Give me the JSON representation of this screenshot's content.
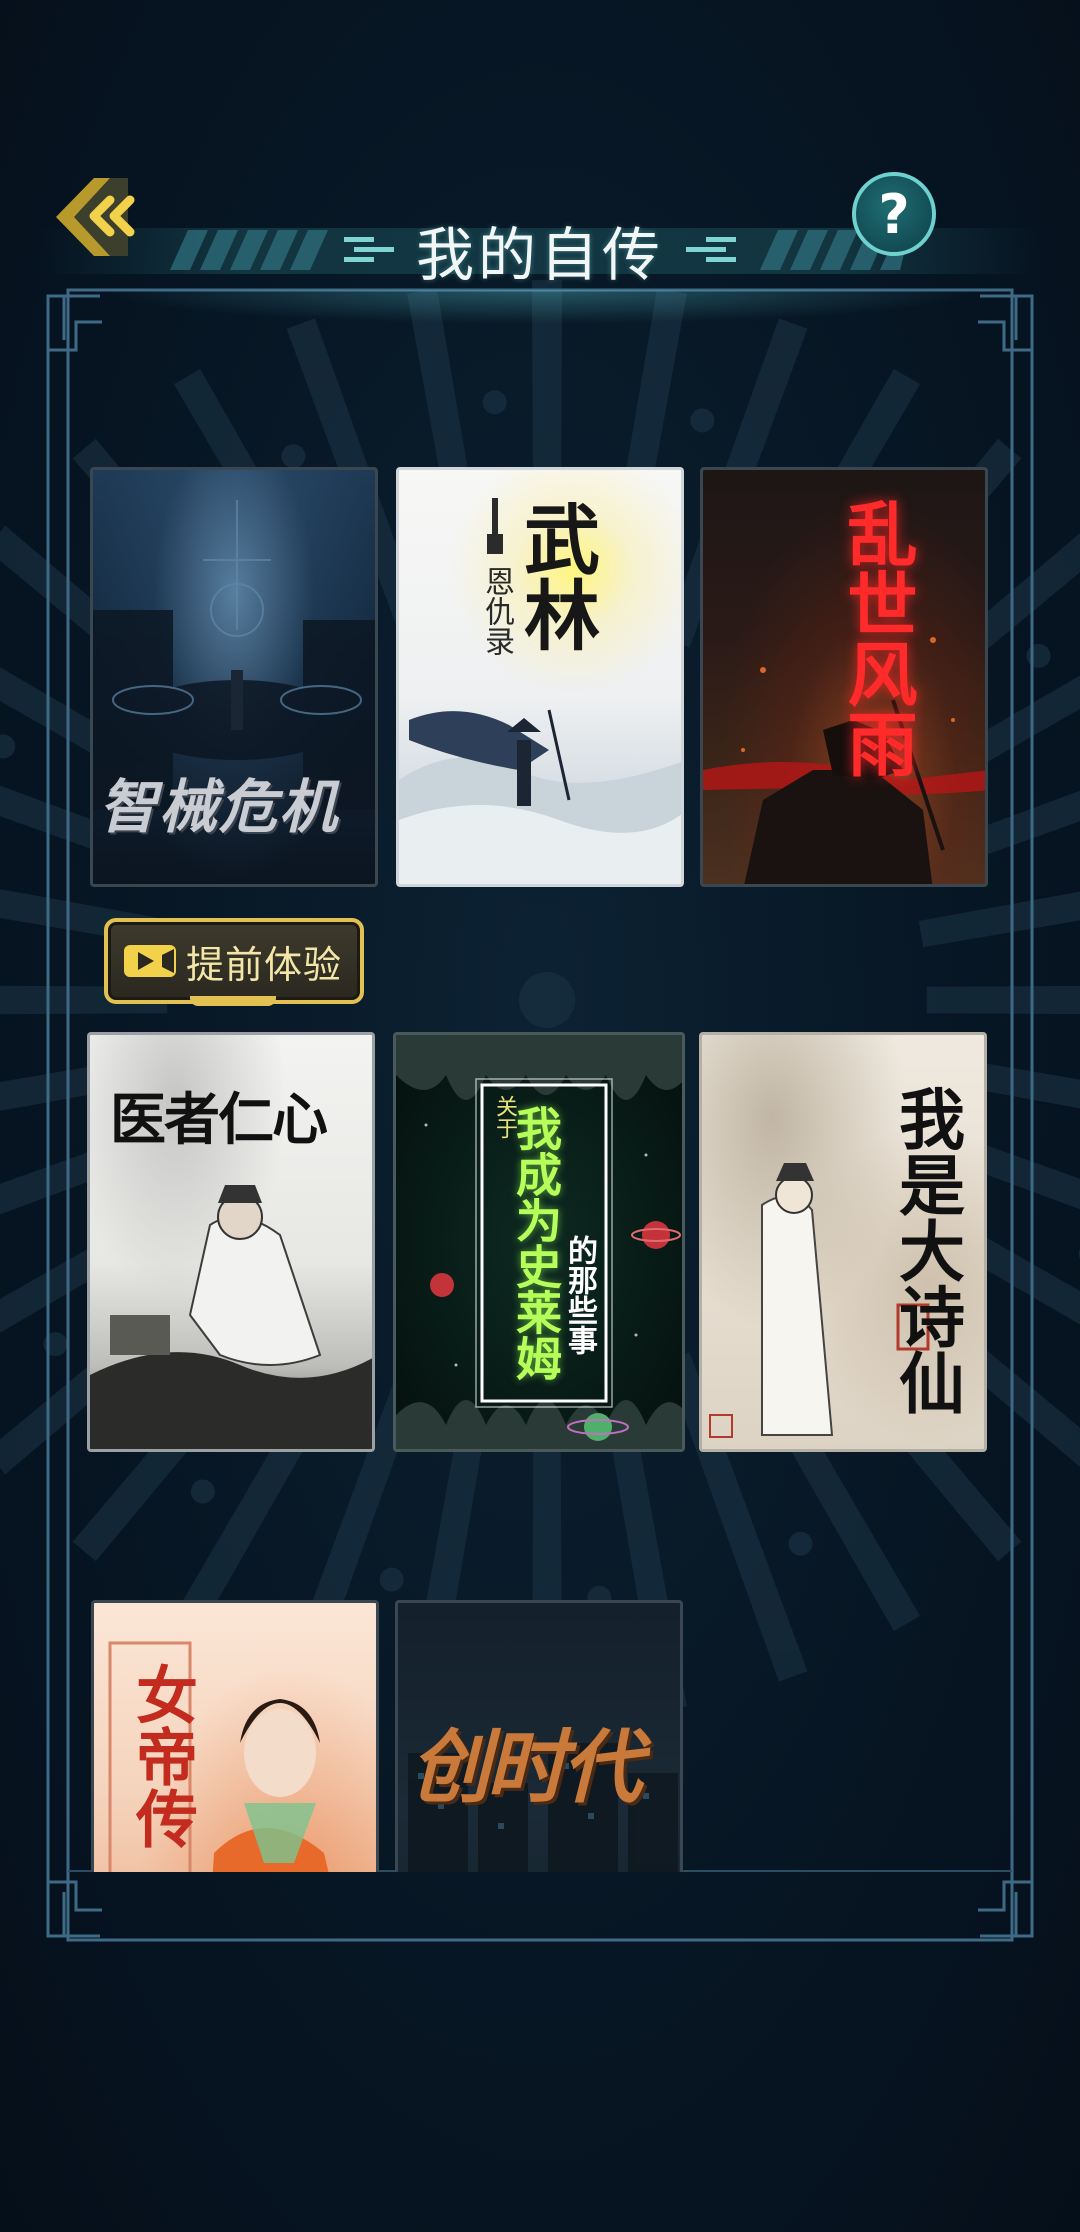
{
  "header": {
    "title": "我的自传",
    "back_icon": "double-chevron-left-icon",
    "help_label": "?"
  },
  "colors": {
    "accent_gold": "#e2c051",
    "accent_teal": "#6fd1cf",
    "background": "#081826",
    "frame": "#3f6a86"
  },
  "preview_badge": {
    "label": "提前体验",
    "icon": "video-camera-icon"
  },
  "stories": [
    {
      "title": "智械危机"
    },
    {
      "title_main": "武林",
      "title_sub": "恩仇录"
    },
    {
      "title": "乱世风雨"
    },
    {
      "title": "医者仁心"
    },
    {
      "title_prefix": "关于",
      "title_main": "我成为史莱姆",
      "title_suffix": "的那些事"
    },
    {
      "title": "我是大诗仙"
    },
    {
      "title": "女帝传"
    },
    {
      "title": "创时代"
    }
  ]
}
